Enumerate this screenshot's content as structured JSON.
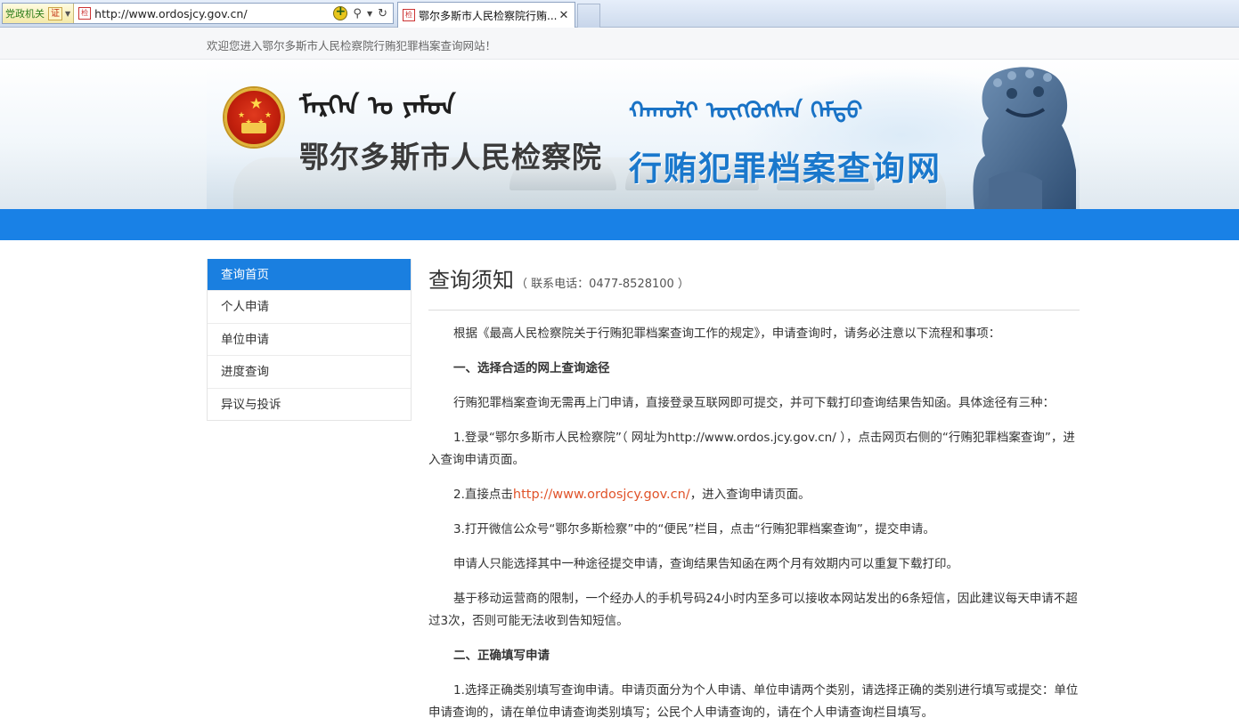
{
  "browser": {
    "gov_tag": "党政机关",
    "gov_badge": "证",
    "url": "http://www.ordosjcy.gov.cn/",
    "tab_title": "鄂尔多斯市人民检察院行贿...",
    "tab_close": "✕"
  },
  "welcome_text": "欢迎您进入鄂尔多斯市人民检察院行贿犯罪档案查询网站！",
  "banner": {
    "org_name": "鄂尔多斯市人民检察院",
    "site_name": "行贿犯罪档案查询网",
    "mongolian_left": "ᠮᠡᠷᠭᠡᠨ ᠤ ᠶᠠᠮᠤᠨ",
    "mongolian_right": "ᠬᠠᠬᠤᠯᠢ ᠥᠭᠭᠦᠭᠰᠡᠨ ᠭᠡᠮᠲᠦ"
  },
  "sidebar": {
    "items": [
      {
        "label": "查询首页",
        "active": true
      },
      {
        "label": "个人申请",
        "active": false
      },
      {
        "label": "单位申请",
        "active": false
      },
      {
        "label": "进度查询",
        "active": false
      },
      {
        "label": "异议与投诉",
        "active": false
      }
    ]
  },
  "main": {
    "title": "查询须知",
    "phone": "（ 联系电话：0477-8528100 ）",
    "intro": "根据《最高人民检察院关于行贿犯罪档案查询工作的规定》，申请查询时，请务必注意以下流程和事项：",
    "section1_title": "一、选择合适的网上查询途径",
    "p1": "行贿犯罪档案查询无需再上门申请，直接登录互联网即可提交，并可下载打印查询结果告知函。具体途径有三种：",
    "p2": "1.登录“鄂尔多斯市人民检察院”（ 网址为http://www.ordos.jcy.gov.cn/ ），点击网页右侧的“行贿犯罪档案查询”，进入查询申请页面。",
    "p3_prefix": "2.直接点击",
    "p3_link": "http://www.ordosjcy.gov.cn/",
    "p3_suffix": "，进入查询申请页面。",
    "p4": "3.打开微信公众号“鄂尔多斯检察”中的“便民”栏目，点击“行贿犯罪档案查询”，提交申请。",
    "p5": "申请人只能选择其中一种途径提交申请，查询结果告知函在两个月有效期内可以重复下载打印。",
    "p6": "基于移动运营商的限制，一个经办人的手机号码24小时内至多可以接收本网站发出的6条短信，因此建议每天申请不超过3次，否则可能无法收到告知短信。",
    "section2_title": "二、正确填写申请",
    "p7": "1.选择正确类别填写查询申请。申请页面分为个人申请、单位申请两个类别，请选择正确的类别进行填写或提交：单位申请查询的，请在单位申请查询类别填写；公民个人申请查询的，请在个人申请查询栏目填写。"
  }
}
